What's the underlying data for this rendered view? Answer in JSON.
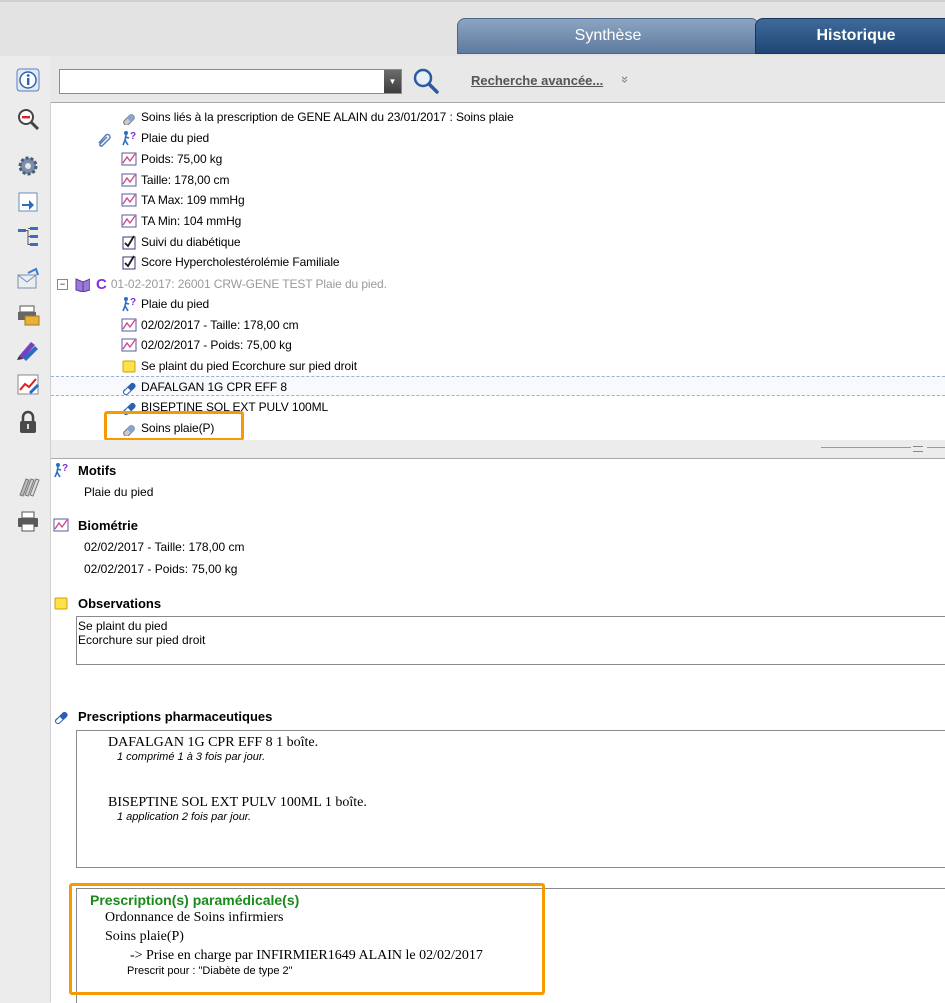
{
  "tabs": {
    "synthese": "Synthèse",
    "historique": "Historique"
  },
  "search": {
    "advanced_label": "Recherche avancée...",
    "advanced_chevron": "»"
  },
  "tree": {
    "items": [
      {
        "icon": "pill-capsule-icon",
        "text": "Soins liés à la prescription de GENE ALAIN du 23/01/2017 : Soins plaie"
      },
      {
        "icon": "walking-question-icon",
        "text": "Plaie du pied"
      },
      {
        "icon": "chart-icon",
        "text": "Poids: 75,00 kg"
      },
      {
        "icon": "chart-icon",
        "text": "Taille: 178,00 cm"
      },
      {
        "icon": "chart-icon",
        "text": "TA Max: 109 mmHg"
      },
      {
        "icon": "chart-icon",
        "text": "TA Min: 104 mmHg"
      },
      {
        "icon": "checklist-icon",
        "text": "Suivi du diabétique"
      },
      {
        "icon": "checklist-icon",
        "text": "Score Hypercholestérolémie Familiale"
      }
    ],
    "consult": {
      "collapse": "−",
      "letter": "C",
      "text": "01-02-2017: 26001 CRW-GENE TEST Plaie du pied."
    },
    "sub_items": [
      {
        "icon": "walking-question-icon",
        "text": "Plaie du pied"
      },
      {
        "icon": "chart-icon",
        "text": "02/02/2017 - Taille: 178,00 cm"
      },
      {
        "icon": "chart-icon",
        "text": "02/02/2017 - Poids: 75,00 kg"
      },
      {
        "icon": "note-icon",
        "text": "Se plaint du pied Ecorchure sur pied droit"
      },
      {
        "icon": "pill-icon",
        "text": "DAFALGAN 1G CPR EFF 8"
      },
      {
        "icon": "pill-icon",
        "text": "BISEPTINE SOL EXT PULV 100ML"
      },
      {
        "icon": "pill-capsule-icon",
        "text": "Soins plaie(P)"
      }
    ]
  },
  "detail": {
    "motifs": {
      "title": "Motifs",
      "text": "Plaie du pied"
    },
    "biometrie": {
      "title": "Biométrie",
      "lines": [
        "02/02/2017 - Taille: 178,00 cm",
        "02/02/2017 - Poids: 75,00 kg"
      ]
    },
    "observations": {
      "title": "Observations",
      "lines": [
        "Se plaint du pied",
        "Ecorchure sur pied droit"
      ]
    },
    "prescriptions": {
      "title": "Prescriptions pharmaceutiques",
      "items": [
        {
          "name": "DAFALGAN 1G CPR EFF 8  1 boîte.",
          "dosage": "1 comprimé  1 à 3 fois par jour."
        },
        {
          "name": "BISEPTINE SOL EXT PULV 100ML  1 boîte.",
          "dosage": "1 application  2 fois par jour."
        }
      ]
    },
    "paramedical": {
      "title": "Prescription(s) paramédicale(s)",
      "ordonnance": "Ordonnance de Soins infirmiers",
      "soins": "Soins plaie(P)",
      "prise": "-> Prise en charge par INFIRMIER1649 ALAIN le 02/02/2017",
      "prescrit": "Prescrit pour : \"Diabète de type 2\""
    }
  },
  "colors": {
    "accent_orange": "#f59a00",
    "tab_active": "#1e4675",
    "tab_inactive": "#6b86a8",
    "paramedical_green": "#1a8a1a",
    "consult_purple": "#8a2be2"
  }
}
